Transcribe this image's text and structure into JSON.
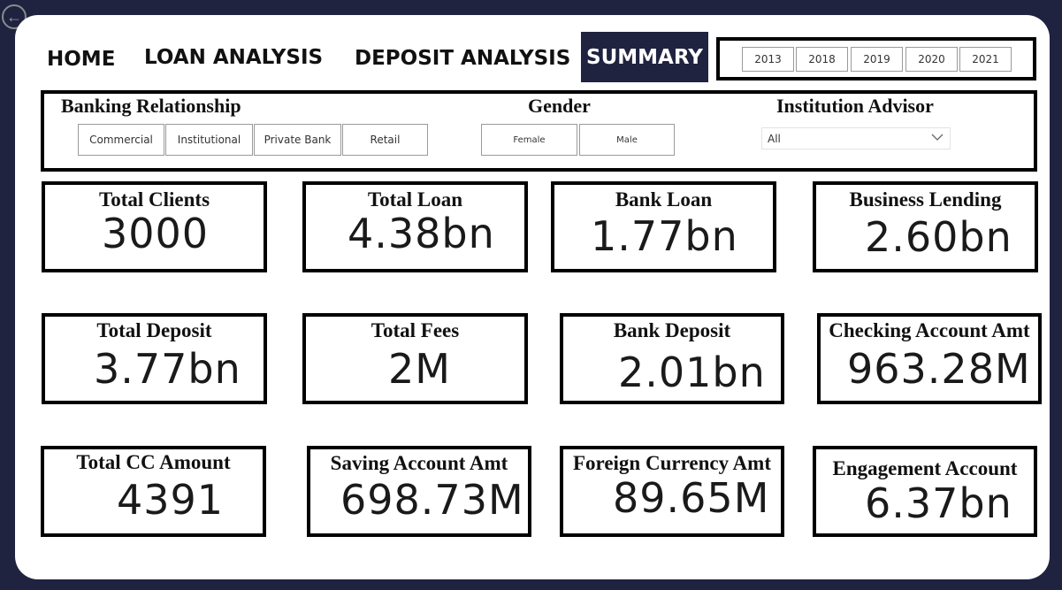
{
  "navigation": {
    "home": "HOME",
    "loan_analysis": "LOAN ANALYSIS",
    "deposit_analysis": "DEPOSIT ANALYSIS",
    "summary": "SUMMARY"
  },
  "years": [
    "2013",
    "2018",
    "2019",
    "2020",
    "2021"
  ],
  "filters": {
    "banking_relationship": {
      "title": "Banking Relationship",
      "options": [
        "Commercial",
        "Institutional",
        "Private Bank",
        "Retail"
      ]
    },
    "gender": {
      "title": "Gender",
      "options": [
        "Female",
        "Male"
      ]
    },
    "institution_advisor": {
      "title": "Institution Advisor",
      "selected": "All"
    }
  },
  "kpis": [
    {
      "title": "Total Clients",
      "value": "3000"
    },
    {
      "title": "Total Loan",
      "value": "4.38bn"
    },
    {
      "title": "Bank Loan",
      "value": "1.77bn"
    },
    {
      "title": "Business Lending",
      "value": "2.60bn"
    },
    {
      "title": "Total Deposit",
      "value": "3.77bn"
    },
    {
      "title": "Total Fees",
      "value": "2M"
    },
    {
      "title": "Bank Deposit",
      "value": "2.01bn"
    },
    {
      "title": "Checking Account Amt",
      "value": "963.28M"
    },
    {
      "title": "Total CC Amount",
      "value": "4391"
    },
    {
      "title": "Saving Account Amt",
      "value": "698.73M"
    },
    {
      "title": "Foreign Currency Amt",
      "value": "89.65M"
    },
    {
      "title": "Engagement Account",
      "value": "6.37bn"
    }
  ],
  "colors": {
    "background": "#1f2340",
    "canvas": "#ffffff",
    "active_tab": "#1f2340"
  }
}
